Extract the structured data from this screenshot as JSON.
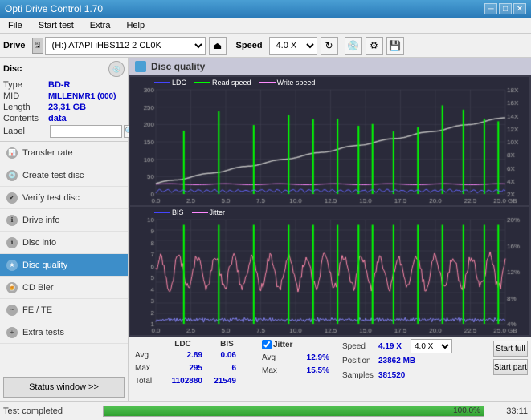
{
  "titlebar": {
    "title": "Opti Drive Control 1.70",
    "min": "─",
    "max": "□",
    "close": "✕"
  },
  "menubar": {
    "items": [
      "File",
      "Start test",
      "Extra",
      "Help"
    ]
  },
  "toolbar": {
    "drive_label": "Drive",
    "drive_value": "(H:) ATAPI iHBS112  2 CL0K",
    "speed_label": "Speed",
    "speed_value": "4.0 X"
  },
  "disc": {
    "title": "Disc",
    "type_label": "Type",
    "type_value": "BD-R",
    "mid_label": "MID",
    "mid_value": "MILLENMR1 (000)",
    "length_label": "Length",
    "length_value": "23,31 GB",
    "contents_label": "Contents",
    "contents_value": "data",
    "label_label": "Label",
    "label_value": ""
  },
  "nav": {
    "items": [
      {
        "id": "transfer-rate",
        "label": "Transfer rate",
        "active": false
      },
      {
        "id": "create-test-disc",
        "label": "Create test disc",
        "active": false
      },
      {
        "id": "verify-test-disc",
        "label": "Verify test disc",
        "active": false
      },
      {
        "id": "drive-info",
        "label": "Drive info",
        "active": false
      },
      {
        "id": "disc-info",
        "label": "Disc info",
        "active": false
      },
      {
        "id": "disc-quality",
        "label": "Disc quality",
        "active": true
      },
      {
        "id": "cd-bier",
        "label": "CD Bier",
        "active": false
      },
      {
        "id": "fe-te",
        "label": "FE / TE",
        "active": false
      },
      {
        "id": "extra-tests",
        "label": "Extra tests",
        "active": false
      }
    ],
    "status_window": "Status window >>"
  },
  "chart": {
    "title": "Disc quality",
    "legend1": [
      {
        "label": "LDC",
        "color": "#0000ff"
      },
      {
        "label": "Read speed",
        "color": "#00ff00"
      },
      {
        "label": "Write speed",
        "color": "#ff00ff"
      }
    ],
    "legend2": [
      {
        "label": "BIS",
        "color": "#0000ff"
      },
      {
        "label": "Jitter",
        "color": "#ff88ff"
      }
    ],
    "y_axis1_left": [
      "300",
      "250",
      "200",
      "150",
      "100",
      "50",
      "0"
    ],
    "y_axis1_right": [
      "18X",
      "16X",
      "14X",
      "12X",
      "10X",
      "8X",
      "6X",
      "4X",
      "2X"
    ],
    "y_axis2_left": [
      "10",
      "9",
      "8",
      "7",
      "6",
      "5",
      "4",
      "3",
      "2",
      "1"
    ],
    "y_axis2_right": [
      "20%",
      "16%",
      "12%",
      "8%",
      "4%"
    ],
    "x_axis": [
      "0.0",
      "2.5",
      "5.0",
      "7.5",
      "10.0",
      "12.5",
      "15.0",
      "17.5",
      "20.0",
      "22.5",
      "25.0 GB"
    ]
  },
  "stats": {
    "headers": [
      "LDC",
      "BIS"
    ],
    "rows": [
      {
        "label": "Avg",
        "ldc": "2.89",
        "bis": "0.06"
      },
      {
        "label": "Max",
        "ldc": "295",
        "bis": "6"
      },
      {
        "label": "Total",
        "ldc": "1102880",
        "bis": "21549"
      }
    ],
    "jitter_checked": true,
    "jitter_label": "Jitter",
    "jitter_rows": [
      {
        "label": "Avg",
        "val": "12.9%"
      },
      {
        "label": "Max",
        "val": "15.5%"
      }
    ],
    "speed_label": "Speed",
    "speed_value": "4.19 X",
    "speed_select": "4.0 X",
    "position_label": "Position",
    "position_value": "23862 MB",
    "samples_label": "Samples",
    "samples_value": "381520",
    "start_full": "Start full",
    "start_part": "Start part"
  },
  "statusbar": {
    "text": "Test completed",
    "progress": 100,
    "progress_text": "100.0%",
    "time": "33:11"
  }
}
